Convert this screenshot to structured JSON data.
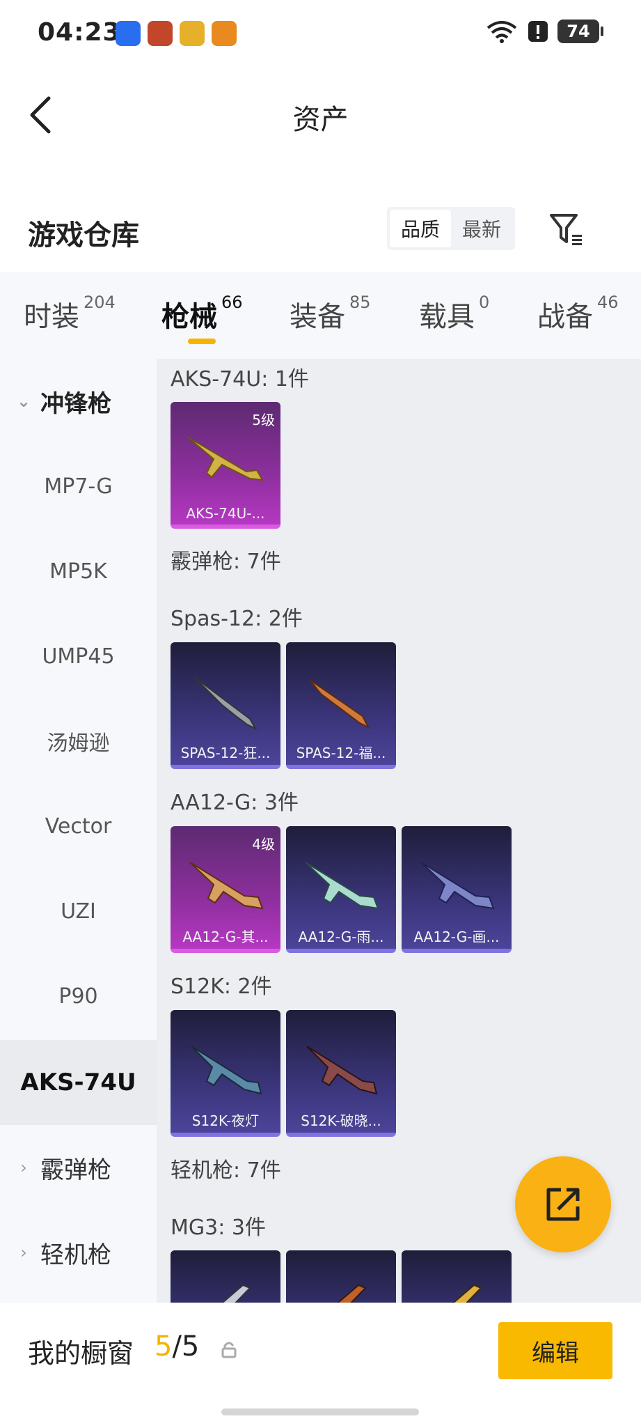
{
  "status": {
    "time": "04:23",
    "battery": "74"
  },
  "header": {
    "title": "资产"
  },
  "warehouse": {
    "title": "游戏仓库",
    "sort_quality": "品质",
    "sort_latest": "最新"
  },
  "tabs": [
    {
      "label": "时装",
      "count": "204"
    },
    {
      "label": "枪械",
      "count": "66"
    },
    {
      "label": "装备",
      "count": "85"
    },
    {
      "label": "载具",
      "count": "0"
    },
    {
      "label": "战备",
      "count": "46"
    }
  ],
  "sidebar": {
    "group_smg": "冲锋枪",
    "items": [
      "MP7-G",
      "MP5K",
      "UMP45",
      "汤姆逊",
      "Vector",
      "UZI",
      "P90",
      "AKS-74U"
    ],
    "group_shotgun": "霰弹枪",
    "group_lmg": "轻机枪"
  },
  "content": {
    "aks_label": "AKS-74U: 1件",
    "aks_card": {
      "level": "5级",
      "name": "AKS-74U-..."
    },
    "shotgun_label": "霰弹枪: 7件",
    "spas_label": "Spas-12: 2件",
    "spas_cards": [
      "SPAS-12-狂...",
      "SPAS-12-福..."
    ],
    "aa12_label": "AA12-G: 3件",
    "aa12_cards": [
      {
        "level": "4级",
        "name": "AA12-G-其..."
      },
      {
        "name": "AA12-G-雨..."
      },
      {
        "name": "AA12-G-画..."
      }
    ],
    "s12k_label": "S12K: 2件",
    "s12k_cards": [
      "S12K-夜灯",
      "S12K-破晓..."
    ],
    "lmg_label": "轻机枪: 7件",
    "mg3_label": "MG3: 3件"
  },
  "bottom": {
    "title": "我的橱窗",
    "count_current": "5",
    "count_total": "/5",
    "edit": "编辑"
  }
}
